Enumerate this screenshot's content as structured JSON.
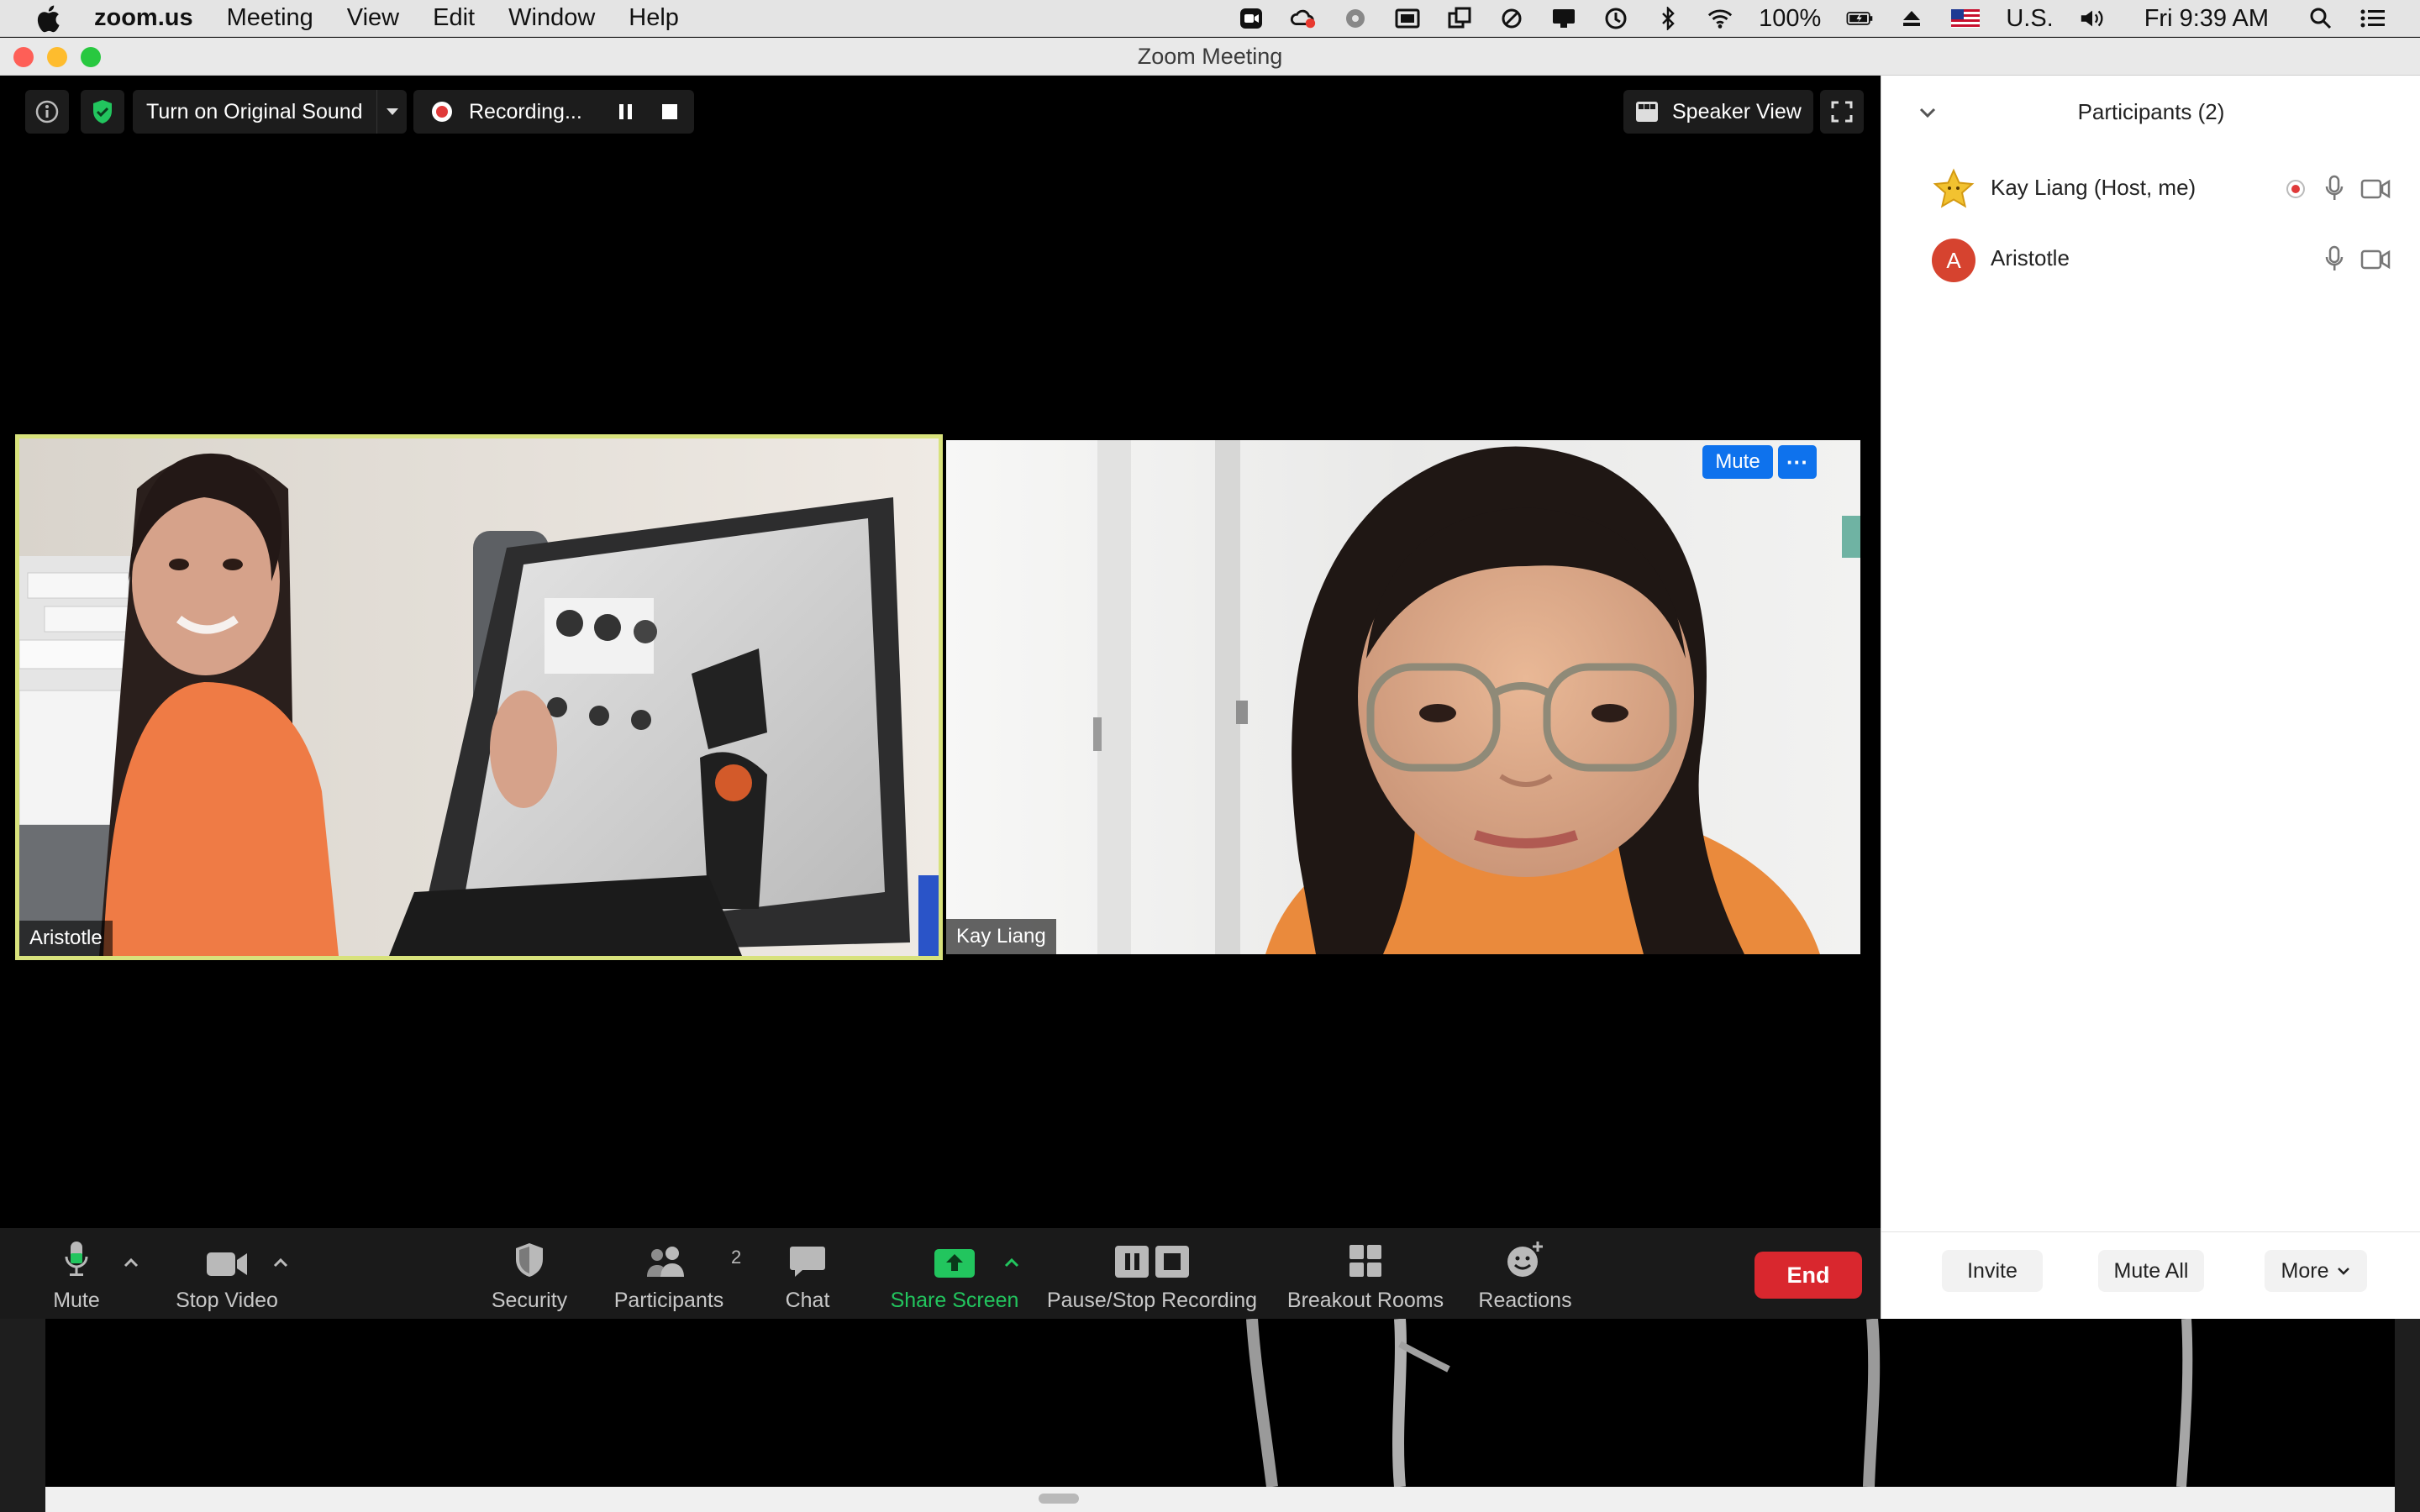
{
  "menubar": {
    "app_name": "zoom.us",
    "menus": [
      "Meeting",
      "View",
      "Edit",
      "Window",
      "Help"
    ],
    "battery": "100%",
    "input_source": "U.S.",
    "clock": "Fri 9:39 AM"
  },
  "window": {
    "title": "Zoom Meeting"
  },
  "topbar": {
    "original_sound_label": "Turn on Original Sound",
    "recording_label": "Recording...",
    "speaker_view_label": "Speaker View"
  },
  "videos": [
    {
      "name": "Aristotle",
      "active_speaker": true
    },
    {
      "name": "Kay Liang",
      "mute_label": "Mute",
      "more_label": "···"
    }
  ],
  "toolbar": {
    "mute_label": "Mute",
    "stop_video_label": "Stop Video",
    "security_label": "Security",
    "participants_label": "Participants",
    "participants_count": "2",
    "chat_label": "Chat",
    "share_screen_label": "Share Screen",
    "recording_label": "Pause/Stop Recording",
    "breakout_label": "Breakout Rooms",
    "reactions_label": "Reactions",
    "end_label": "End",
    "share_color": "#22c55e",
    "end_color": "#d9272e"
  },
  "participants_panel": {
    "title": "Participants (2)",
    "participants": [
      {
        "name": "Kay Liang (Host, me)",
        "avatar": "star-avatar",
        "recording": true
      },
      {
        "name": "Aristotle",
        "avatar_letter": "A",
        "avatar_color": "#d6432f"
      }
    ],
    "invite_label": "Invite",
    "mute_all_label": "Mute All",
    "more_label": "More"
  }
}
